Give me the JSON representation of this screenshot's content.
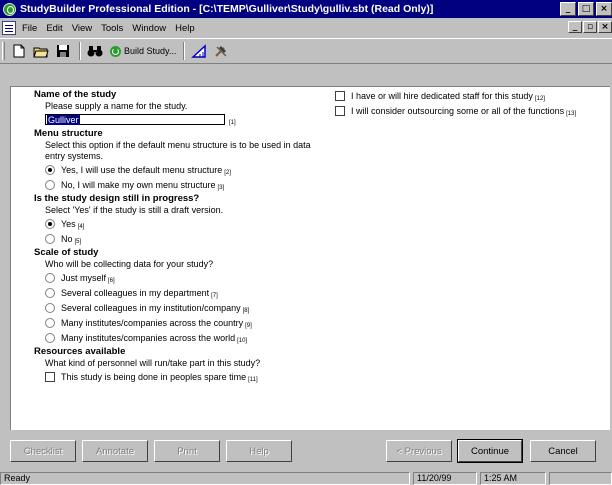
{
  "window": {
    "title": "StudyBuilder Professional Edition - [C:\\TEMP\\Gulliver\\Study\\gulliv.sbt (Read Only)]"
  },
  "menus": [
    {
      "label": "File"
    },
    {
      "label": "Edit"
    },
    {
      "label": "View"
    },
    {
      "label": "Tools"
    },
    {
      "label": "Window"
    },
    {
      "label": "Help"
    }
  ],
  "toolbar": {
    "build_label": "Build Study..."
  },
  "form": {
    "name": {
      "heading": "Name of the study",
      "prompt": "Please supply a name for the study.",
      "value": "Gulliver",
      "num": "[1]"
    },
    "menu": {
      "heading": "Menu structure",
      "prompt": "Select this option if the default menu structure is to be used in data entry systems.",
      "options": [
        {
          "label": "Yes, I will use the default menu structure",
          "num": "[2]",
          "checked": true
        },
        {
          "label": "No, I will make my own menu structure",
          "num": "[3]",
          "checked": false
        }
      ]
    },
    "progress": {
      "heading": "Is the study design still in progress?",
      "prompt": "Select 'Yes' if the study is still a draft version.",
      "options": [
        {
          "label": "Yes",
          "num": "[4]",
          "checked": true
        },
        {
          "label": "No",
          "num": "[5]",
          "checked": false
        }
      ]
    },
    "scale": {
      "heading": "Scale of study",
      "prompt": "Who will be collecting data for your study?",
      "options": [
        {
          "label": "Just myself",
          "num": "[6]"
        },
        {
          "label": "Several colleagues in my department",
          "num": "[7]"
        },
        {
          "label": "Several colleagues in my institution/company",
          "num": "[8]"
        },
        {
          "label": "Many institutes/companies across the country",
          "num": "[9]"
        },
        {
          "label": "Many institutes/companies across the world",
          "num": "[10]"
        }
      ]
    },
    "resources": {
      "heading": "Resources available",
      "prompt": "What kind of personnel will run/take part in this study?",
      "options": [
        {
          "label": "This study is being done in peoples spare time",
          "num": "[11]"
        },
        {
          "label": "I have or will hire dedicated staff for this study",
          "num": "[12]"
        },
        {
          "label": "I will consider outsourcing some or all of the functions",
          "num": "[13]"
        }
      ]
    }
  },
  "buttons": {
    "checklist": "Checklist",
    "annotate": "Annotate",
    "print": "Print",
    "help": "Help",
    "previous": "< Previous",
    "continue": "Continue",
    "cancel": "Cancel"
  },
  "status": {
    "text": "Ready",
    "date": "11/20/99",
    "time": "1:25 AM"
  }
}
